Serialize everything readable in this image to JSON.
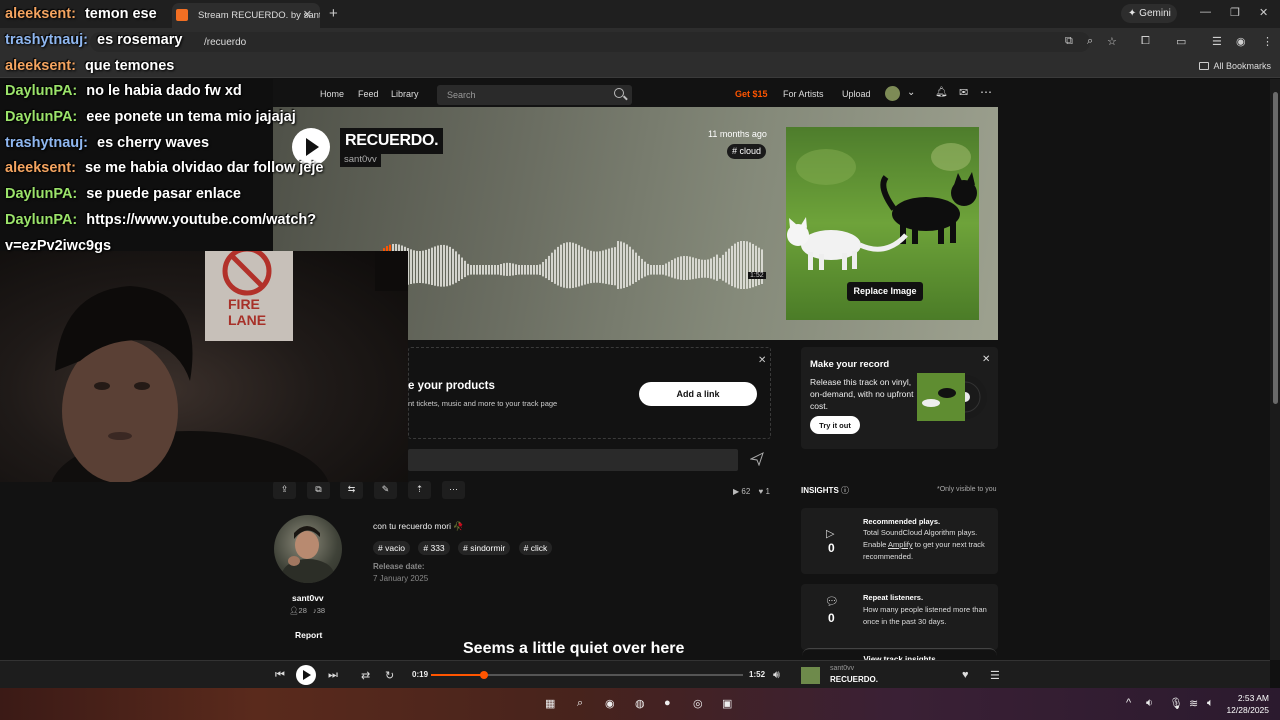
{
  "browser": {
    "tab_title": "Stream RECUERDO. by sant0vv",
    "url_suffix": "/recuerdo",
    "gemini_label": "Gemini",
    "all_bookmarks": "All Bookmarks"
  },
  "header": {
    "nav": [
      "Home",
      "Feed",
      "Library"
    ],
    "search_placeholder": "Search",
    "get_pro": "Get $15",
    "for_artists": "For Artists",
    "upload": "Upload"
  },
  "hero": {
    "title": "RECUERDO.",
    "artist": "sant0vv",
    "posted": "11 months ago",
    "tag": "# cloud",
    "duration": "1:52",
    "replace_image": "Replace Image"
  },
  "promo": {
    "title": "e your products",
    "subtitle": "nt tickets, music and more to your track page",
    "add_link": "Add a link"
  },
  "record": {
    "title": "Make your record",
    "text": "Release this track on vinyl, on-demand, with no upfront cost.",
    "try_it": "Try it out"
  },
  "track_stats": {
    "plays": "62",
    "likes": "1"
  },
  "insights": {
    "heading": "INSIGHTS",
    "visibility": "*Only visible to you",
    "cards": [
      {
        "title": "Recommended plays.",
        "value": "0",
        "text_a": "Total SoundCloud Algorithm plays. Enable ",
        "link": "Amplify",
        "text_b": " to get your next track recommended."
      },
      {
        "title": "Repeat listeners.",
        "value": "0",
        "text_a": "How many people listened more than once in the past 30 days.",
        "link": "",
        "text_b": ""
      }
    ],
    "view_all": "View track insights"
  },
  "artist": {
    "name": "sant0vv",
    "followers": "28",
    "tracks": "38",
    "report": "Report",
    "description": "con tu recuerdo mori 🥀",
    "tags": [
      "# vacio",
      "# 333",
      "# sindormir",
      "# click"
    ],
    "release_label": "Release date:",
    "release_date": "7 January 2025"
  },
  "empty_comments": "Seems a little quiet over here",
  "player": {
    "elapsed": "0:19",
    "total": "1:52",
    "progress": 0.17,
    "artist": "sant0vv",
    "title": "RECUERDO."
  },
  "taskbar": {
    "time": "2:53 AM",
    "date": "12/28/2025"
  },
  "chat": [
    {
      "user": "aleeksent:",
      "msg": "temon ese",
      "color": "#f4a460"
    },
    {
      "user": "trashytnauj:",
      "msg": "es rosemary",
      "color": "#8fb7f0"
    },
    {
      "user": "aleeksent:",
      "msg": "que temones",
      "color": "#f4a460"
    },
    {
      "user": "DaylunPA:",
      "msg": "no le habia dado fw xd",
      "color": "#9be36a"
    },
    {
      "user": "DaylunPA:",
      "msg": "eee ponete un tema mio jajajaj",
      "color": "#9be36a"
    },
    {
      "user": "trashytnauj:",
      "msg": "es cherry waves",
      "color": "#8fb7f0"
    },
    {
      "user": "aleeksent:",
      "msg": "se me habia olvidao dar follow jeje",
      "color": "#f4a460"
    },
    {
      "user": "DaylunPA:",
      "msg": "se puede pasar enlace",
      "color": "#9be36a"
    },
    {
      "user": "DaylunPA:",
      "msg": "https://www.youtube.com/watch?",
      "color": "#9be36a"
    },
    {
      "user": "",
      "msg": "v=ezPv2iwc9gs",
      "color": "#ffffff"
    }
  ],
  "colors": {
    "brand_orange": "#ff5500",
    "background": "#121212"
  }
}
